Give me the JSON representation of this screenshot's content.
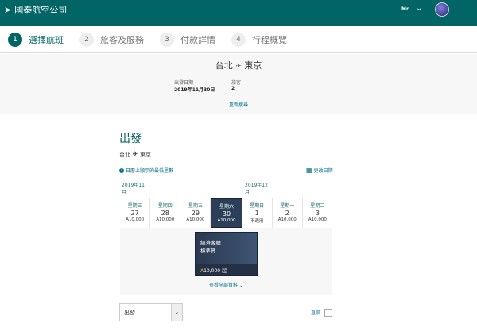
{
  "header": {
    "logo_text": "國泰航空公司",
    "title_label": "Mr"
  },
  "steps": [
    {
      "n": "1",
      "label": "選擇航班"
    },
    {
      "n": "2",
      "label": "旅客及服務"
    },
    {
      "n": "3",
      "label": "付款詳情"
    },
    {
      "n": "4",
      "label": "行程概覽"
    }
  ],
  "summary": {
    "origin": "台北",
    "destination": "東京",
    "date_label": "出發日期",
    "date": "2019年11月30日",
    "pax_label": "旅客",
    "pax": "2",
    "research": "重新搜尋"
  },
  "main": {
    "title": "出發",
    "origin": "台北",
    "destination": "東京",
    "info": "日曆上顯示的最低里數",
    "change_date": "更改日期",
    "months": [
      "2019年11月",
      "2019年12月"
    ],
    "days": [
      {
        "w": "星期三",
        "d": "27",
        "p": "A10,000"
      },
      {
        "w": "星期四",
        "d": "28",
        "p": "A10,000"
      },
      {
        "w": "星期五",
        "d": "29",
        "p": "A10,000"
      },
      {
        "w": "星期六",
        "d": "30",
        "p": "A10,000",
        "selected": true
      },
      {
        "w": "星期日",
        "d": "1",
        "p": "不適用"
      },
      {
        "w": "星期一",
        "d": "2",
        "p": "A10,000"
      },
      {
        "w": "星期二",
        "d": "3",
        "p": "A10,000"
      }
    ],
    "card": {
      "cabin": "經濟客艙",
      "type": "標準賞",
      "price": "10,000 起"
    },
    "more": "查看全部資料",
    "sort_value": "出發",
    "direct_label": "直航"
  }
}
